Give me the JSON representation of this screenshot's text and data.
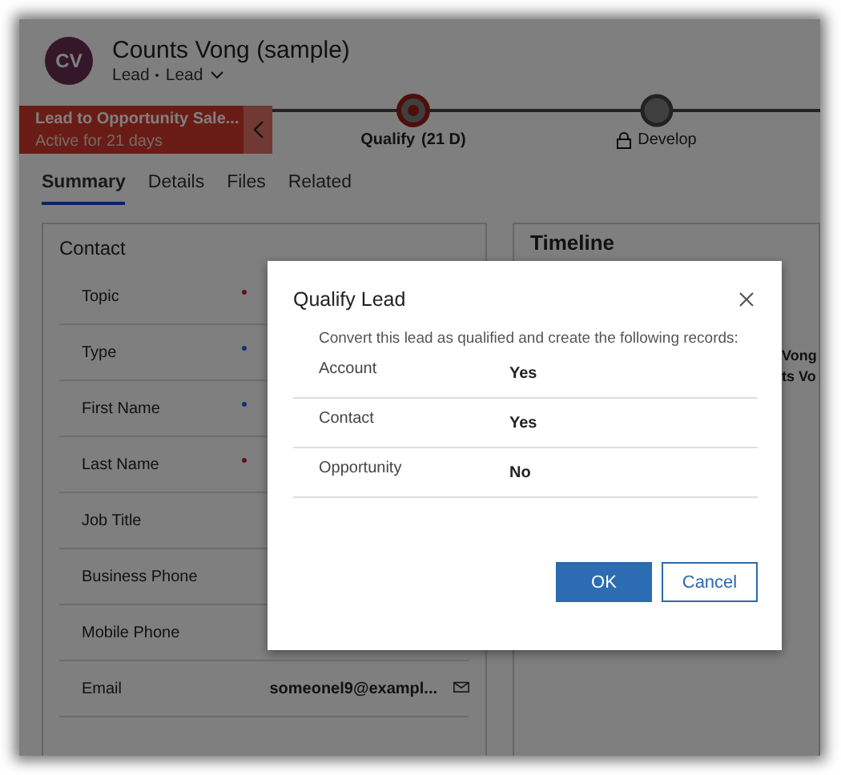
{
  "record": {
    "initials": "CV",
    "title": "Counts Vong (sample)",
    "entity": "Lead",
    "form": "Lead"
  },
  "process": {
    "name": "Lead to Opportunity Sale...",
    "status": "Active for 21 days",
    "stages": [
      {
        "label": "Qualify",
        "duration": "(21 D)",
        "selected": true,
        "locked": false
      },
      {
        "label": "Develop",
        "selected": false,
        "locked": true
      }
    ]
  },
  "tabs": [
    {
      "label": "Summary",
      "selected": true
    },
    {
      "label": "Details",
      "selected": false
    },
    {
      "label": "Files",
      "selected": false
    },
    {
      "label": "Related",
      "selected": false
    }
  ],
  "contact": {
    "title": "Contact",
    "fields": [
      {
        "label": "Topic",
        "required": true,
        "recommended": false
      },
      {
        "label": "Type",
        "required": false,
        "recommended": true
      },
      {
        "label": "First Name",
        "required": false,
        "recommended": true
      },
      {
        "label": "Last Name",
        "required": true,
        "recommended": false
      },
      {
        "label": "Job Title",
        "required": false,
        "recommended": false
      },
      {
        "label": "Business Phone",
        "required": false,
        "recommended": false
      },
      {
        "label": "Mobile Phone",
        "required": false,
        "recommended": false
      },
      {
        "label": "Email",
        "required": false,
        "recommended": false,
        "value": "someonel9@exampl...",
        "kind": "email"
      }
    ]
  },
  "timeline": {
    "title": "Timeline",
    "snippets": [
      "Vong",
      "ts Vo"
    ]
  },
  "dialog": {
    "title": "Qualify Lead",
    "message": "Convert this lead as qualified and create the following records:",
    "rows": [
      {
        "label": "Account",
        "value": "Yes"
      },
      {
        "label": "Contact",
        "value": "Yes"
      },
      {
        "label": "Opportunity",
        "value": "No"
      }
    ],
    "buttons": [
      {
        "label": "OK",
        "kind": "primary"
      },
      {
        "label": "Cancel",
        "kind": "secondary"
      }
    ]
  }
}
